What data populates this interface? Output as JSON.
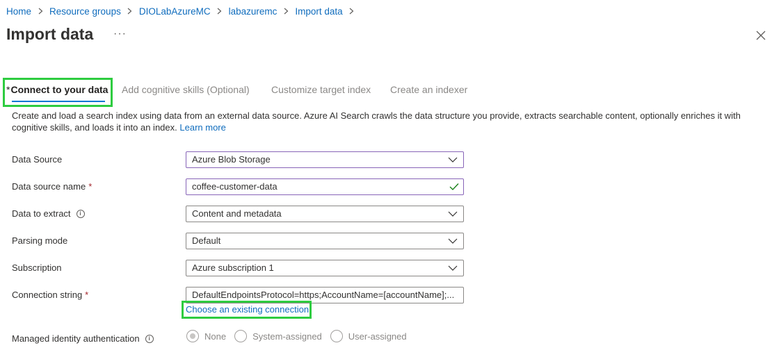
{
  "breadcrumb": [
    "Home",
    "Resource groups",
    "DIOLabAzureMC",
    "labazuremc",
    "Import data"
  ],
  "page": {
    "title": "Import data",
    "more_label": "···"
  },
  "tabs": [
    {
      "label": "Connect to your data",
      "required": "*",
      "active": true
    },
    {
      "label": "Add cognitive skills (Optional)",
      "active": false
    },
    {
      "label": "Customize target index",
      "active": false
    },
    {
      "label": "Create an indexer",
      "active": false
    }
  ],
  "description": {
    "text": "Create and load a search index using data from an external data source. Azure AI Search crawls the data structure you provide, extracts searchable content, optionally enriches it with cognitive skills, and loads it into an index.",
    "link": "Learn more"
  },
  "form": {
    "data_source": {
      "label": "Data Source",
      "value": "Azure Blob Storage"
    },
    "data_source_name": {
      "label": "Data source name",
      "required": "*",
      "value": "coffee-customer-data"
    },
    "data_to_extract": {
      "label": "Data to extract",
      "value": "Content and metadata"
    },
    "parsing_mode": {
      "label": "Parsing mode",
      "value": "Default"
    },
    "subscription": {
      "label": "Subscription",
      "value": "Azure subscription 1"
    },
    "connection_string": {
      "label": "Connection string",
      "required": "*",
      "value": "DefaultEndpointsProtocol=https;AccountName=[accountName];..."
    },
    "choose_connection_link": "Choose an existing connection",
    "managed_identity": {
      "label": "Managed identity authentication",
      "options": [
        "None",
        "System-assigned",
        "User-assigned"
      ],
      "selected": "None"
    }
  },
  "colors": {
    "link": "#0f6cbd",
    "tab_underline": "#0078d4",
    "highlight": "#2ecc40",
    "required": "#a4262c",
    "focus_border": "#8764b8",
    "valid_check": "#107c10"
  },
  "icons": {
    "breadcrumb_separator": "chevron-right-icon",
    "close": "close-icon",
    "dropdown": "chevron-down-icon",
    "valid": "checkmark-icon",
    "info": "info-icon"
  }
}
